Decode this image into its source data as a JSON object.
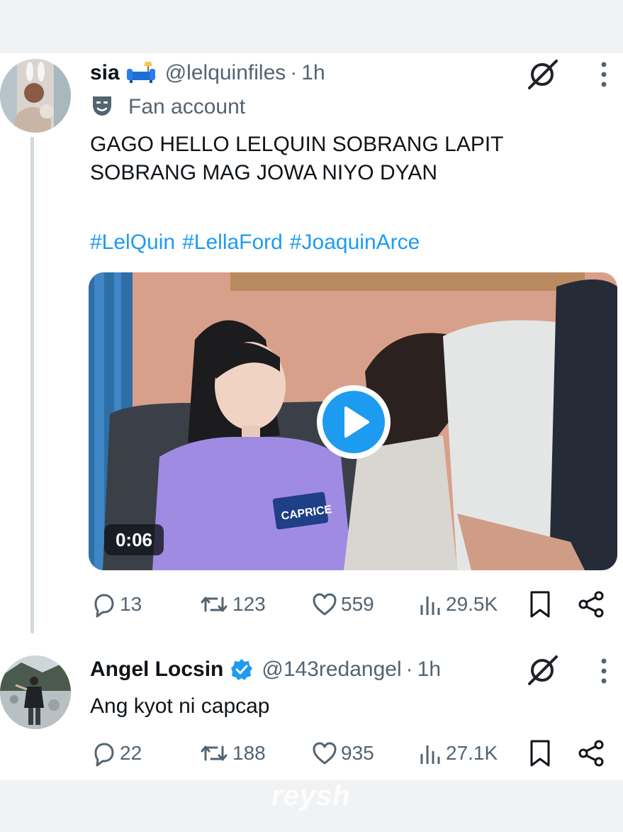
{
  "colors": {
    "accent": "#1d9bf0",
    "verified": "#1d9bf0",
    "muted": "#536471",
    "text": "#0f1419"
  },
  "tweets": [
    {
      "name": "sia",
      "name_emoji": "couch-and-lamp-emoji",
      "handle": "@lelquinfiles",
      "separator": "·",
      "time": "1h",
      "label_icon": "theater-masks-icon",
      "label": "Fan account",
      "text_lines": [
        "GAGO HELLO LELQUIN SOBRANG LAPIT",
        "SOBRANG MAG JOWA NIYO DYAN"
      ],
      "hashtags": [
        "#LelQuin",
        "#LellaFord",
        "#JoaquinArce"
      ],
      "media": {
        "duration": "0:06",
        "badge_text": "CAPRICE",
        "play_icon": "play-icon"
      },
      "stats": {
        "replies": "13",
        "reposts": "123",
        "likes": "559",
        "views": "29.5K"
      }
    },
    {
      "name": "Angel Locsin",
      "verified": true,
      "handle": "@143redangel",
      "separator": "·",
      "time": "1h",
      "text": "Ang kyot ni capcap",
      "stats": {
        "replies": "22",
        "reposts": "188",
        "likes": "935",
        "views": "27.1K"
      }
    }
  ],
  "watermark": "reysh"
}
